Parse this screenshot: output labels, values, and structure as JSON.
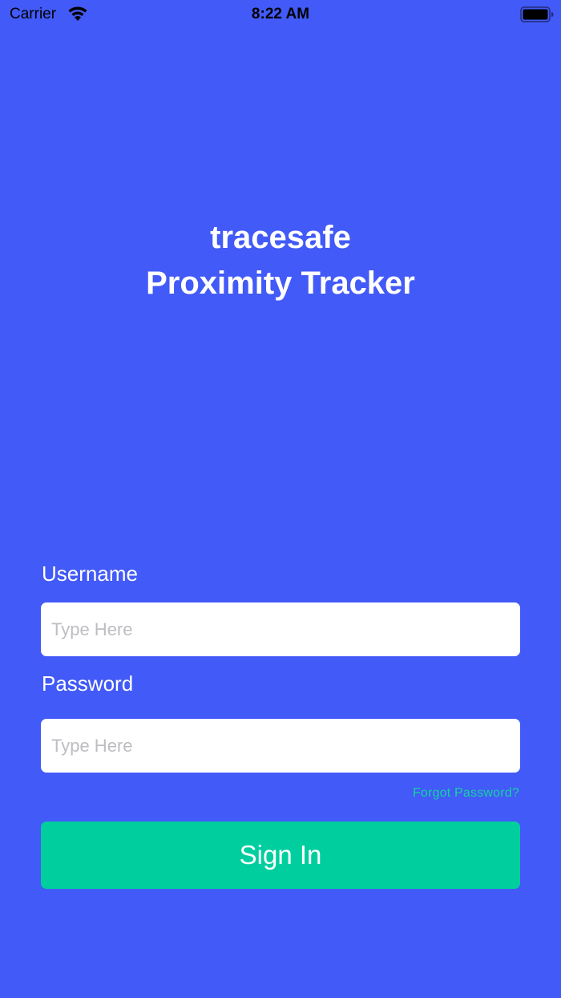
{
  "status_bar": {
    "carrier": "Carrier",
    "time": "8:22 AM",
    "wifi_icon": "wifi-icon",
    "battery_icon": "battery-full-icon"
  },
  "app": {
    "title_line1": "tracesafe",
    "title_line2": "Proximity Tracker"
  },
  "form": {
    "username_label": "Username",
    "username_placeholder": "Type Here",
    "password_label": "Password",
    "password_placeholder": "Type Here",
    "forgot_password": "Forgot Password?",
    "sign_in_label": "Sign In"
  },
  "colors": {
    "background": "#425AF7",
    "accent_green": "#00CE9E",
    "link_green": "#13D3A2",
    "input_background": "#FFFFFF",
    "placeholder": "#BDBDC3"
  }
}
